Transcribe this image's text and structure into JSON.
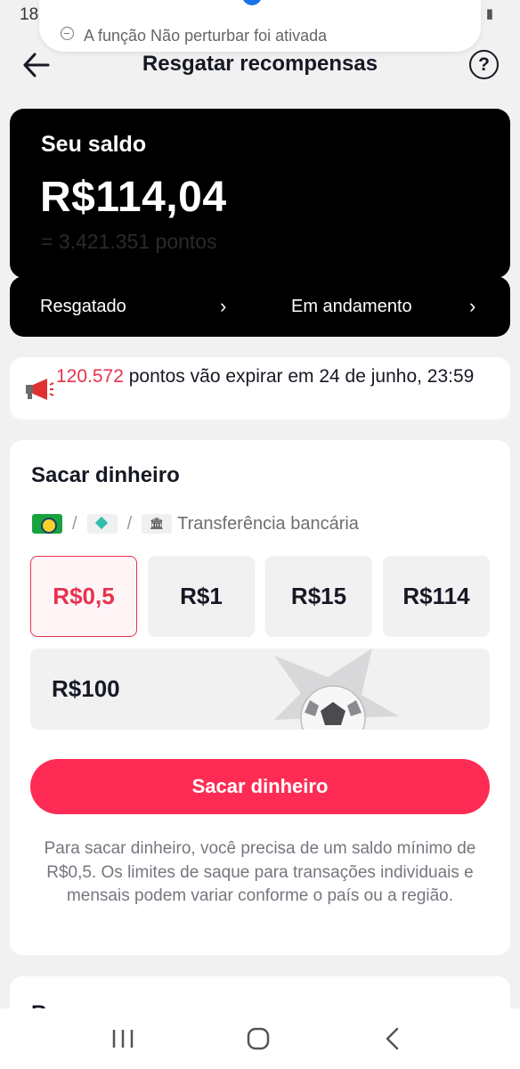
{
  "status_bar": {
    "time": "18:28",
    "left_icons": "◎ ✈ ♟ •",
    "right_icons": "⏰ ◔ ▮"
  },
  "dnd_banner": {
    "text": "A função Não perturbar foi ativada"
  },
  "header": {
    "title": "Resgatar recompensas",
    "back_icon": "arrow-left",
    "help_icon": "question-circle",
    "help_symbol": "?"
  },
  "balance": {
    "label": "Seu saldo",
    "amount": "R$114,04",
    "points": "= 3.421.351 pontos"
  },
  "history": {
    "redeemed_label": "Resgatado",
    "in_progress_label": "Em andamento",
    "chevron": "›"
  },
  "expiry": {
    "points": "120.572",
    "text": " pontos vão expirar em 24 de junho, 23:59"
  },
  "withdraw": {
    "title": "Sacar dinheiro",
    "methods": {
      "separator": "/",
      "bank_icon": "🏛",
      "bank_label": "Transferência bancária"
    },
    "amounts": [
      "R$0,5",
      "R$1",
      "R$15",
      "R$114"
    ],
    "selected_amount": "R$0,5",
    "wide_amount": "R$100",
    "button_label": "Sacar dinheiro",
    "note": "Para sacar dinheiro, você precisa de um saldo mínimo de R$0,5. Os limites de saque para transações individuais e mensais podem variar conforme o país ou a região."
  },
  "next_section": {
    "title_partial": "R"
  },
  "colors": {
    "accent": "#fe2c55",
    "accent_text": "#e8324f",
    "card_dark": "#000000",
    "background": "#f1f1f2"
  },
  "nav_bar": {
    "recent_icon": "recent-apps",
    "home_icon": "home",
    "back_icon": "back"
  }
}
